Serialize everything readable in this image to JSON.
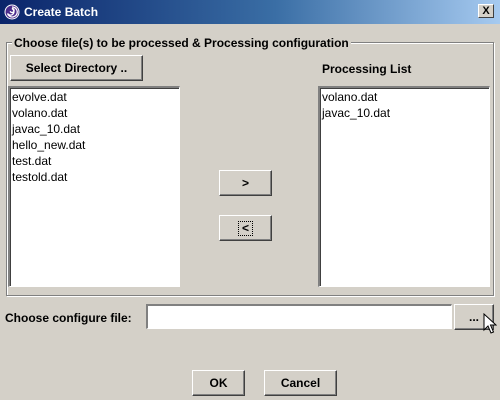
{
  "window": {
    "title": "Create Batch",
    "close_label": "X"
  },
  "group": {
    "title": "Choose file(s) to be processed & Processing configuration"
  },
  "select_directory_label": "Select Directory ..",
  "source_files": [
    "evolve.dat",
    "volano.dat",
    "javac_10.dat",
    "hello_new.dat",
    "test.dat",
    "testold.dat"
  ],
  "processing_list": {
    "title": "Processing List",
    "items": [
      "volano.dat",
      "javac_10.dat"
    ]
  },
  "move_right_label": ">",
  "move_left_label": "<",
  "configure": {
    "label": "Choose configure file:",
    "value": "",
    "browse_label": "..."
  },
  "ok_label": "OK",
  "cancel_label": "Cancel",
  "icons": {
    "app": "spiral-app-icon",
    "cursor": "mouse-pointer-icon"
  },
  "colors": {
    "title_start": "#0a246a",
    "title_end": "#a6caf0",
    "face": "#d4d0c8"
  }
}
